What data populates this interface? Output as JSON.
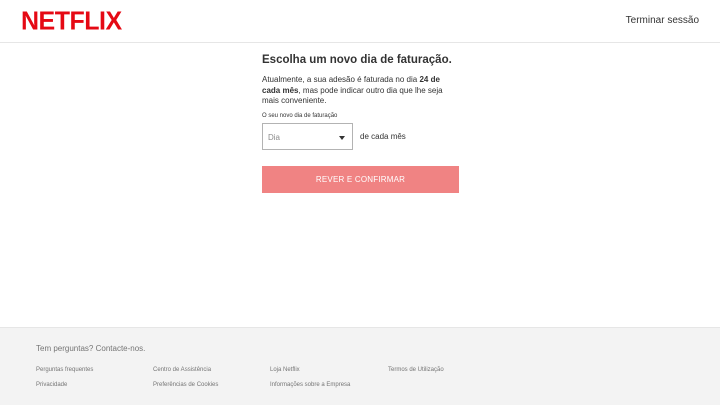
{
  "header": {
    "logo": "NETFLIX",
    "signout_label": "Terminar sessão",
    "brand_color": "#e50914"
  },
  "main": {
    "title": "Escolha um novo dia de faturação.",
    "desc_prefix": "Atualmente, a sua adesão é faturada no dia ",
    "desc_bold": "24 de cada mês",
    "desc_suffix": ", mas pode indicar outro dia que lhe seja mais conveniente.",
    "field_label": "O seu novo dia de faturação",
    "select_value": "Dia",
    "select_suffix": "de cada mês",
    "confirm_label": "REVER E CONFIRMAR",
    "confirm_color": "#f08383"
  },
  "footer": {
    "contact": "Tem perguntas? Contacte-nos.",
    "links": [
      "Perguntas frequentes",
      "Centro de Assistência",
      "Loja Netflix",
      "Termos de Utilização",
      "Privacidade",
      "Preferências de Cookies",
      "Informações sobre a Empresa"
    ]
  }
}
